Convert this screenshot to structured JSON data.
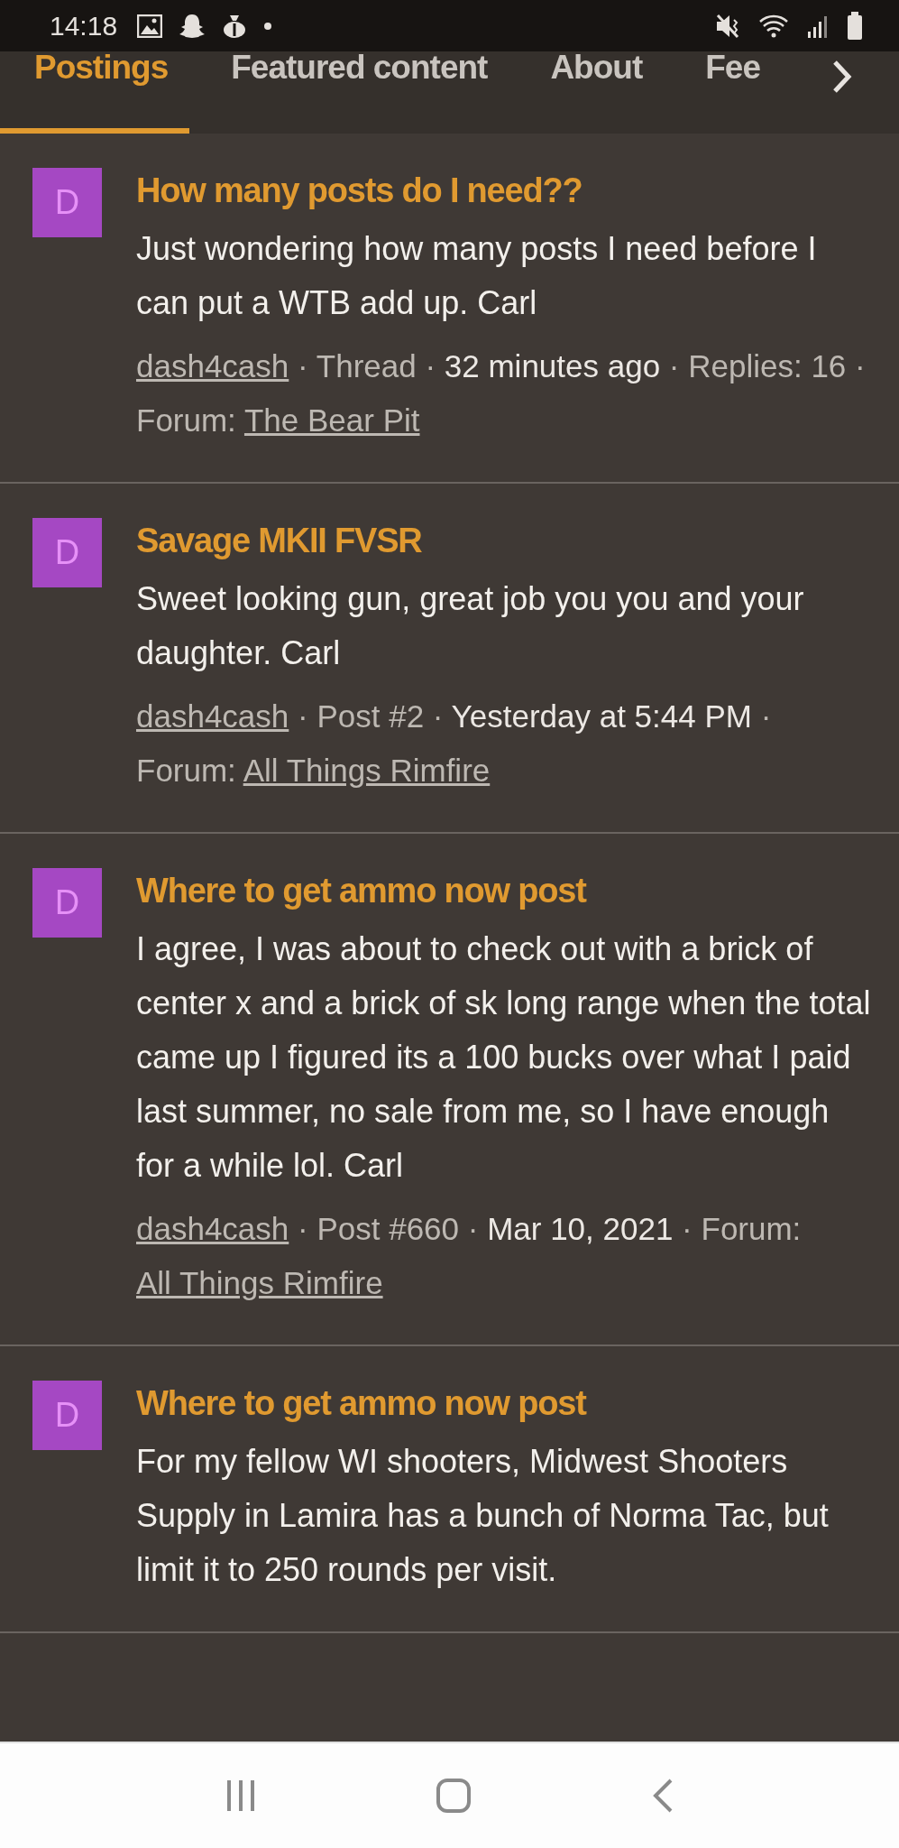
{
  "status_bar": {
    "time": "14:18"
  },
  "tabs": [
    {
      "label": "Postings",
      "selected": true
    },
    {
      "label": "Featured content",
      "selected": false
    },
    {
      "label": "About",
      "selected": false
    },
    {
      "label": "Fee",
      "selected": false
    }
  ],
  "separator": "·",
  "postings": [
    {
      "avatar": "D",
      "title": "How many posts do I need??",
      "body": "Just wondering how many posts I need before I can put a WTB add up. Carl",
      "meta": [
        [
          {
            "kind": "link",
            "text": "dash4cash"
          }
        ],
        [
          {
            "kind": "plain",
            "text": "Thread"
          }
        ],
        [
          {
            "kind": "date",
            "text": "32 minutes ago"
          }
        ],
        [
          {
            "kind": "plain",
            "text": "Replies: 16"
          }
        ],
        [
          {
            "kind": "plain",
            "text": "Forum:"
          },
          {
            "kind": "link",
            "text": "The Bear Pit"
          }
        ]
      ]
    },
    {
      "avatar": "D",
      "title": "Savage MKII FVSR",
      "body": "Sweet looking gun, great job you you and your daughter. Carl",
      "meta": [
        [
          {
            "kind": "link",
            "text": "dash4cash"
          }
        ],
        [
          {
            "kind": "plain",
            "text": "Post #2"
          }
        ],
        [
          {
            "kind": "date",
            "text": "Yesterday at 5:44 PM"
          }
        ],
        [
          {
            "kind": "plain",
            "text": "Forum:"
          },
          {
            "kind": "link",
            "text": "All Things Rimfire"
          }
        ]
      ]
    },
    {
      "avatar": "D",
      "title": "Where to get ammo now post",
      "body": "I agree, I was about to check out with a brick of center x and a brick of sk long range when the total came up I figured its a 100 bucks over what I paid last summer, no sale from me, so I have enough for a while lol. Carl",
      "meta": [
        [
          {
            "kind": "link",
            "text": "dash4cash"
          }
        ],
        [
          {
            "kind": "plain",
            "text": "Post #660"
          }
        ],
        [
          {
            "kind": "date",
            "text": "Mar 10, 2021"
          }
        ],
        [
          {
            "kind": "plain",
            "text": "Forum:"
          },
          {
            "kind": "link",
            "text": "All Things Rimfire"
          }
        ]
      ]
    },
    {
      "avatar": "D",
      "title": "Where to get ammo now post",
      "body": "For my fellow WI shooters, Midwest Shooters Supply in Lamira has a bunch of Norma Tac, but limit it to 250 rounds per visit."
    }
  ]
}
